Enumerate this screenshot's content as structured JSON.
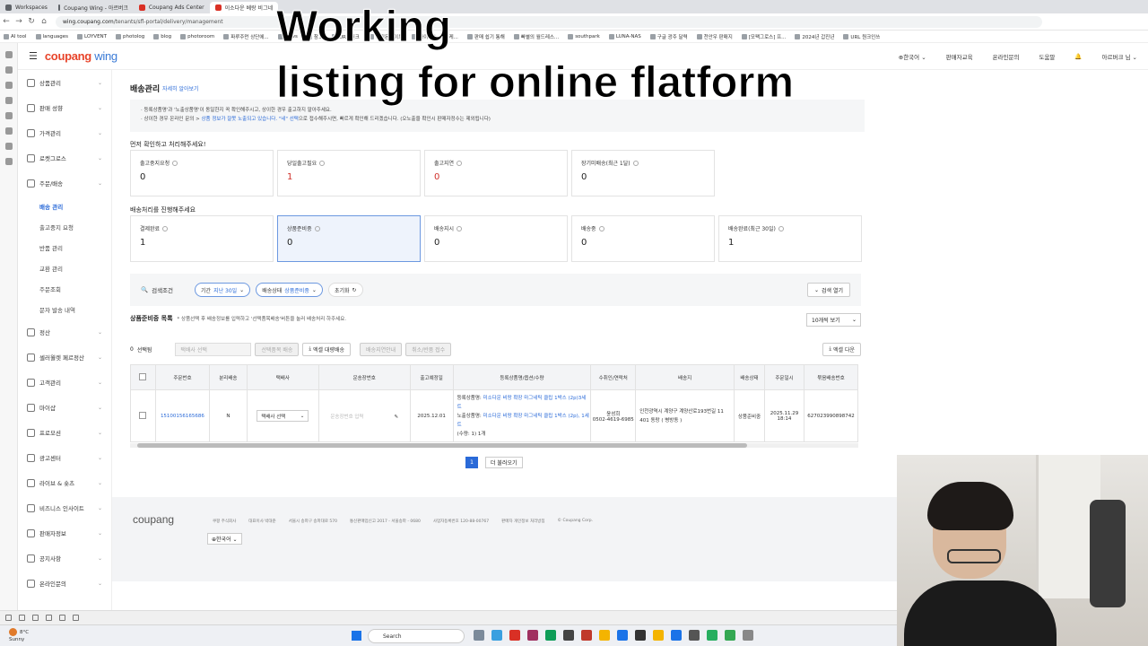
{
  "browser": {
    "tabs": [
      {
        "label": "Workspaces",
        "color": "#5f6368",
        "active": false
      },
      {
        "label": "Coupang Wing - 아르버크",
        "color": "#5f6368",
        "active": false
      },
      {
        "label": "Coupang Ads Center",
        "color": "#d93025",
        "active": false
      },
      {
        "label": "이소다운 베랑 비그네",
        "color": "#d93025",
        "active": true
      }
    ],
    "url_host": "wing.coupang.com",
    "url_path": "/tenants/sfl-portal/delivery/management",
    "bookmarks": [
      "AI tool",
      "languages",
      "LOYVENT",
      "photolog",
      "blog",
      "photoroom",
      "파루주먼 상단에...",
      "news",
      "참고",
      "URL 원크",
      "쇼핑몬사이트",
      "아이템스 > 마케...",
      "판매 쉽기 통해",
      "빠별의 월드레스...",
      "southpark",
      "LUNA-NAS",
      "구글 광주 달력",
      "천안우 판매지",
      "[모팩그로스] 프...",
      "2024년 갑진년",
      "URL 원크인쓰"
    ]
  },
  "app": {
    "logo_main": "coupang",
    "logo_sub": "wing",
    "header_nav": [
      "⊕한국어 ⌄",
      "판매자교육",
      "온라인문의",
      "도움말",
      "아르버크 님 ⌄"
    ]
  },
  "sidebar": {
    "items": [
      {
        "label": "상품관리",
        "icon": "box-icon"
      },
      {
        "label": "판매 성향",
        "icon": "trend-icon"
      },
      {
        "label": "가격관리",
        "icon": "price-icon"
      },
      {
        "label": "로켓그로스",
        "icon": "rocket-icon"
      },
      {
        "label": "주문/배송",
        "icon": "truck-icon"
      }
    ],
    "subitems": [
      {
        "label": "배송 관리",
        "active": true
      },
      {
        "label": "출고중지 요청",
        "active": false
      },
      {
        "label": "반품 관리",
        "active": false
      },
      {
        "label": "교환 관리",
        "active": false
      },
      {
        "label": "주문조회",
        "active": false
      },
      {
        "label": "문자 발송 내역",
        "active": false
      }
    ],
    "items2": [
      {
        "label": "정산",
        "icon": "coin-icon"
      },
      {
        "label": "셀러월렛 페르정산",
        "icon": "wallet-icon"
      },
      {
        "label": "고객관리",
        "icon": "customer-icon"
      },
      {
        "label": "마이샵",
        "icon": "shop-icon"
      },
      {
        "label": "프로모션",
        "icon": "promo-icon"
      },
      {
        "label": "광고센터",
        "icon": "ad-icon"
      },
      {
        "label": "라이브 & 숏츠",
        "icon": "live-icon"
      },
      {
        "label": "비즈니스 인사이트",
        "icon": "insight-icon"
      },
      {
        "label": "판매자정보",
        "icon": "seller-icon"
      },
      {
        "label": "공지사항",
        "icon": "notice-icon"
      },
      {
        "label": "온라인문의",
        "icon": "inquiry-icon"
      }
    ]
  },
  "page": {
    "title": "배송관리",
    "title_link": "자세히 알아보기",
    "notice_line1": "· 등록상품명'과 '노출상품명'이 동일한지 꼭 확인해주시고, 상이한 경우 출고하지 말아주세요.",
    "notice_line2_a": "· 상이한 경우 온라인 문의 > ",
    "notice_line2_link": "상품 정보가 잘못 노출되고 있습니다. \"네\" 선택",
    "notice_line2_b": "으로 접수해주시면, 빠르게 확인해 드리겠습니다. (오노출을 확인시 판매자정수는 제외됩니다)",
    "section1": "먼저 확인하고 처리해주세요!",
    "cards1": [
      {
        "label": "출고중지요청",
        "value": "0",
        "red": false
      },
      {
        "label": "당일출고필요",
        "value": "1",
        "red": true
      },
      {
        "label": "출고지연",
        "value": "0",
        "red": true
      },
      {
        "label": "장기미배송(최근 1달)",
        "value": "0",
        "red": false
      }
    ],
    "section2": "배송처리를 진행해주세요",
    "cards2": [
      {
        "label": "결제완료",
        "value": "1",
        "selected": false
      },
      {
        "label": "상품준비중",
        "value": "0",
        "selected": true
      },
      {
        "label": "배송지시",
        "value": "0",
        "selected": false
      },
      {
        "label": "배송중",
        "value": "0",
        "selected": false
      },
      {
        "label": "배송완료(최근 30일)",
        "value": "1",
        "selected": false
      }
    ],
    "filter": {
      "label": "검색조건",
      "chip1_key": "기간",
      "chip1_val": "지난 30일",
      "chip2_key": "배송상태",
      "chip2_val": "상품준비중",
      "reset": "초기화",
      "open": "검색 열기"
    },
    "list_title": "상품준비중 목록",
    "list_hint": "* 상품선택 후 배송정보를 입력하고 '선택품목배송'버튼을 눌러 배송처리 하주세요.",
    "per_page": "10개씩 보기",
    "selected_count": "0",
    "selected_label": "선택됨",
    "courier_select": "택배사 선택",
    "btn_selected_ship": "선택품목 배송",
    "btn_excel_ship": "엑셀 대량배송",
    "btn_ship_notice": "배송지연안내",
    "btn_cancel": "취소/반품 접수",
    "btn_excel_download": "엑셀 다운",
    "columns": [
      "주문번호",
      "분리배송",
      "택배사",
      "운송장번호",
      "출고예정일",
      "등록상품명/옵션/수량",
      "수취인/연락처",
      "배송지",
      "배송상태",
      "주문일시",
      "묶음배송번호"
    ],
    "row": {
      "order_no": "15100156165686",
      "split": "N",
      "courier": "택배사 선택",
      "tracking_placeholder": "운송장번호 입력",
      "ship_date": "2025.12.01",
      "prod_reg_label": "등록상품명:",
      "prod_reg": "미소다운 비랑 확장 마그네틱 클립 1박스 (2p)3세트",
      "prod_exp_label": "노출상품명:",
      "prod_exp": "미소다운 비랑 확장 마그네틱 클립 1박스 (2p), 1세트",
      "qty": "(수량: 1) 1개",
      "receiver": "윤성희",
      "phone": "0502-4619-6985",
      "address": "인천광역시 계양구 계양산로193번길 11 401 동랑 ( 병방동 )",
      "status": "상품준비중",
      "order_dt": "2025.11.29 18:14",
      "bundle_no": "627023990898742"
    },
    "pager_current": "1",
    "pager_more": "더 불러오기"
  },
  "footer": {
    "logo": "coupang",
    "links": [
      "쿠팡 주식회사",
      "대표이사 박대준",
      "서울시 송파구 송파대로 570",
      "통신판매업신고 2017 - 서울송파 - 0680",
      "사업자등록번호 120-88-00767",
      "판매자 개인정보 처리방침",
      "© Coupang Corp."
    ],
    "lang": "⊕한국어 ⌄"
  },
  "overlay": {
    "line1": "Working",
    "line2": "listing for online flatform"
  },
  "taskbar": {
    "temp": "8°C",
    "weather": "Sunny",
    "search": "Search",
    "tray_colors": [
      "#7b8a9a",
      "#3aa0e0",
      "#d93025",
      "#a03060",
      "#0f9d58",
      "#444",
      "#c0392b",
      "#f4b400",
      "#1a73e8",
      "#333",
      "#f4b400",
      "#1a73e8",
      "#555",
      "#27ae60",
      "#34a853",
      "#888"
    ]
  }
}
